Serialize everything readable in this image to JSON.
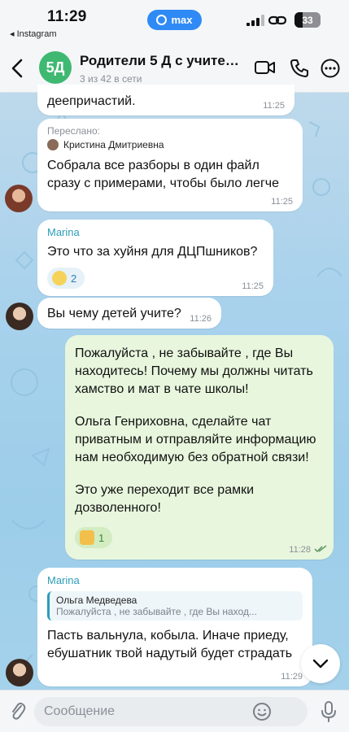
{
  "status_bar": {
    "time": "11:29",
    "back_app": "◂ Instagram",
    "center_pill": "max",
    "battery": "33"
  },
  "header": {
    "avatar_text": "5Д",
    "title": "Родители 5 Д с учите…",
    "subtitle": "3 из 42 в сети"
  },
  "messages": [
    {
      "text": "деепричастий.",
      "time": "11:25"
    },
    {
      "forwarded_label": "Переслано:",
      "forwarded_from": "Кристина Дмитриевна",
      "text": "Собрала все разборы в один файл сразу с примерами, чтобы было легче",
      "time": "11:25"
    },
    {
      "sender": "Marina",
      "text": "Это что за хуйня для ДЦПшников?",
      "reaction_count": "2",
      "time": "11:25"
    },
    {
      "text": "Вы чему детей учите?",
      "time": "11:26"
    },
    {
      "paragraphs": [
        "Пожалуйста , не забывайте , где Вы находитесь! Почему мы должны читать хамство и мат в чате школы!",
        "Ольга Генриховна, сделайте чат приватным и отправляйте информацию нам необходимую без обратной связи!",
        "Это уже переходит все рамки дозволенного!"
      ],
      "reaction_count": "1",
      "time": "11:28"
    },
    {
      "sender": "Marina",
      "quote_name": "Ольга Медведева",
      "quote_text": "Пожалуйста , не забывайте , где Вы наход...",
      "text": "Пасть вальнула, кобыла. Иначе приеду, ебушатник твой надутый будет страдать",
      "time": "11:29"
    }
  ],
  "input": {
    "placeholder": "Сообщение"
  },
  "colors": {
    "accent": "#2f8af5",
    "sender_name": "#2b9cb8",
    "group_avatar": "#3fb872",
    "outgoing_bubble": "#e8f6dd"
  }
}
